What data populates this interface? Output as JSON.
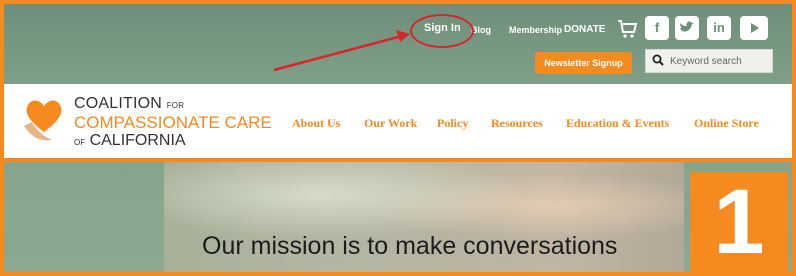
{
  "topbar": {
    "sign_in": "Sign In",
    "blog": "Blog",
    "membership": "Membership",
    "donate": "DONATE",
    "newsletter": "Newsletter Signup",
    "search_placeholder": "Keyword search",
    "social_icons": [
      "cart-icon",
      "facebook-icon",
      "twitter-icon",
      "linkedin-icon",
      "youtube-icon"
    ]
  },
  "logo": {
    "line1": "COALITION",
    "line1_small": "FOR",
    "line2": "COMPASSIONATE CARE",
    "line3_small": "OF",
    "line3": "CALIFORNIA"
  },
  "nav": {
    "items": [
      "About Us",
      "Our Work",
      "Policy",
      "Resources",
      "Education & Events",
      "Online Store"
    ]
  },
  "hero": {
    "mission_line1": "Our mission is to make conversations"
  },
  "annotation": {
    "step_number": "1",
    "callout_color": "#d7262b",
    "accent_color": "#f58a1f"
  }
}
